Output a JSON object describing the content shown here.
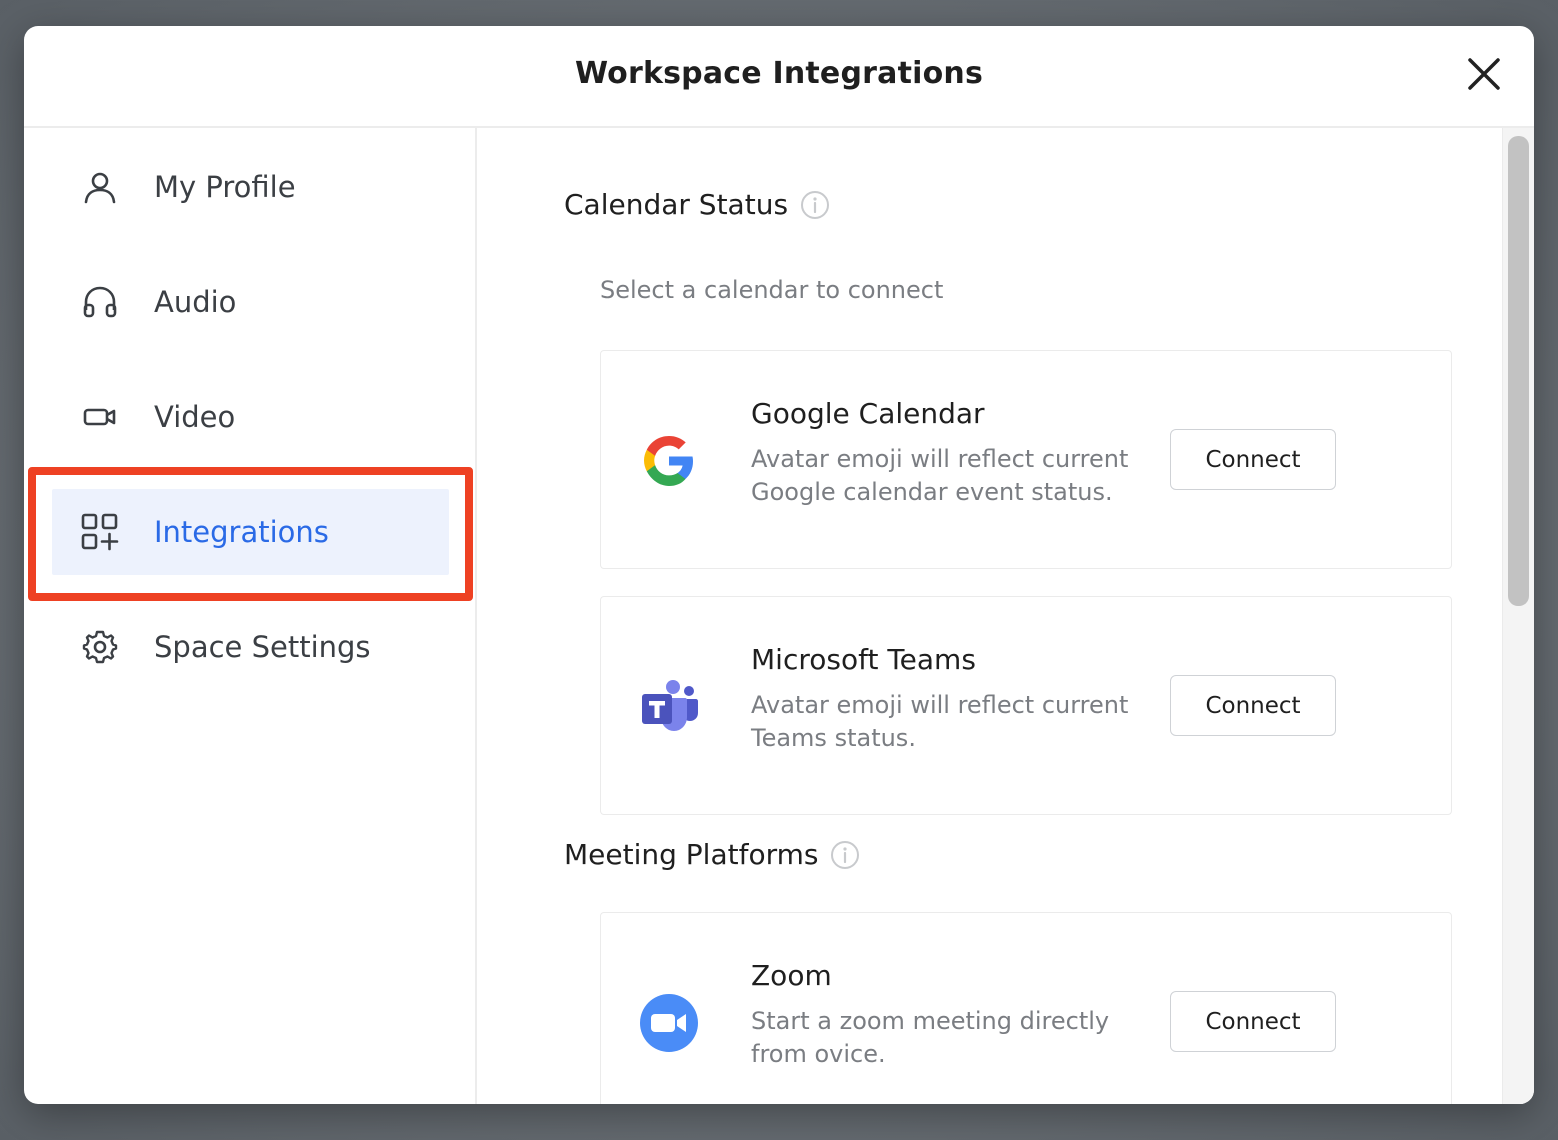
{
  "header": {
    "title": "Workspace Integrations"
  },
  "sidebar": {
    "items": [
      {
        "label": "My Profile",
        "icon": "user-icon"
      },
      {
        "label": "Audio",
        "icon": "headphones-icon"
      },
      {
        "label": "Video",
        "icon": "video-camera-icon"
      },
      {
        "label": "Integrations",
        "icon": "apps-add-icon",
        "active": true
      },
      {
        "label": "Space Settings",
        "icon": "gear-icon"
      }
    ]
  },
  "calendar": {
    "title": "Calendar Status",
    "subtitle": "Select a calendar to connect",
    "cards": [
      {
        "name": "Google Calendar",
        "description": "Avatar emoji will reflect current Google calendar event status.",
        "button": "Connect",
        "icon": "google-logo-icon"
      },
      {
        "name": "Microsoft Teams",
        "description": "Avatar emoji will reflect current Teams status.",
        "button": "Connect",
        "icon": "teams-logo-icon"
      }
    ]
  },
  "meetings": {
    "title": "Meeting Platforms",
    "cards": [
      {
        "name": "Zoom",
        "description": "Start a zoom meeting directly from ovice.",
        "button": "Connect",
        "icon": "zoom-logo-icon"
      }
    ]
  },
  "colors": {
    "accent": "#2a6ae6",
    "highlight": "#ee4123",
    "active_bg": "#edf2fd"
  }
}
